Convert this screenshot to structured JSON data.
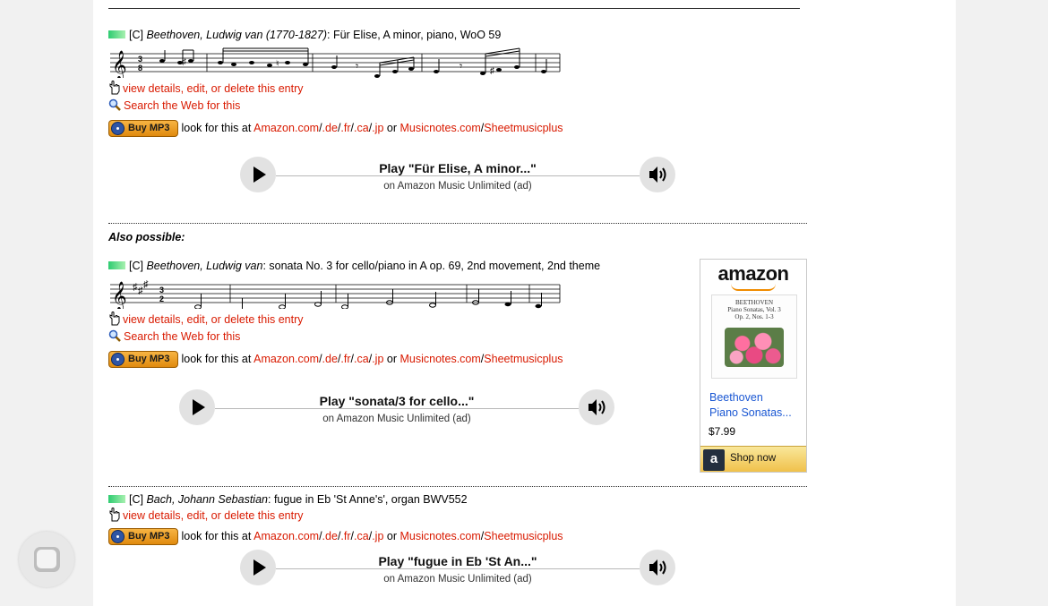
{
  "entries": [
    {
      "tag": "[C]",
      "composer": "Beethoven, Ludwig van (1770-1827)",
      "work": ": Für Elise, A minor, piano, WoO 59",
      "has_search": true,
      "player_title": "Play \"Für Elise, A minor...\"",
      "player_sub": "on Amazon Music Unlimited (ad)"
    },
    {
      "tag": "[C]",
      "composer": "Beethoven, Ludwig van",
      "work": ": sonata No. 3 for cello/piano in A op. 69, 2nd movement, 2nd theme",
      "has_search": true,
      "player_title": "Play \"sonata/3 for cello...\"",
      "player_sub": "on Amazon Music Unlimited (ad)"
    },
    {
      "tag": "[C]",
      "composer": "Bach, Johann Sebastian",
      "work": ": fugue in Eb 'St Anne's', organ BWV552",
      "has_search": false,
      "player_title": "Play \"fugue in Eb 'St An...\"",
      "player_sub": "on Amazon Music Unlimited (ad)"
    }
  ],
  "links": {
    "details": "view details, edit, or delete this entry",
    "search": "Search the Web for this",
    "buy": "Buy MP3",
    "look": "look for this at",
    "amazon": "Amazon.com",
    "de": ".de",
    "fr": ".fr",
    "ca": ".ca",
    "jp": ".jp",
    "or": "or",
    "musicnotes": "Musicnotes.com",
    "sheetmusicplus": "Sheetmusicplus",
    "slash": "/"
  },
  "also_possible": "Also possible:",
  "ad": {
    "logo": "amazon",
    "cover_line1": "BEETHOVEN",
    "cover_line2": "Piano Sonatas, Vol. 3",
    "cover_line3": "Op. 2, Nos. 1-3",
    "product_line1": "Beethoven",
    "product_line2": "Piano Sonatas...",
    "price": "$7.99",
    "shop_label": "Shop now",
    "shop_icon": "a"
  },
  "colors": {
    "link": "#d91a00",
    "ad_link": "#1a57d3",
    "buy_button": "#f0a030",
    "quality_bar": "#2ecc71"
  },
  "icons": {
    "play": "play-icon",
    "volume": "speaker-icon",
    "details": "hand-pointer-icon",
    "search": "magnifier-icon",
    "fingerprint": "fingerprint-icon"
  }
}
